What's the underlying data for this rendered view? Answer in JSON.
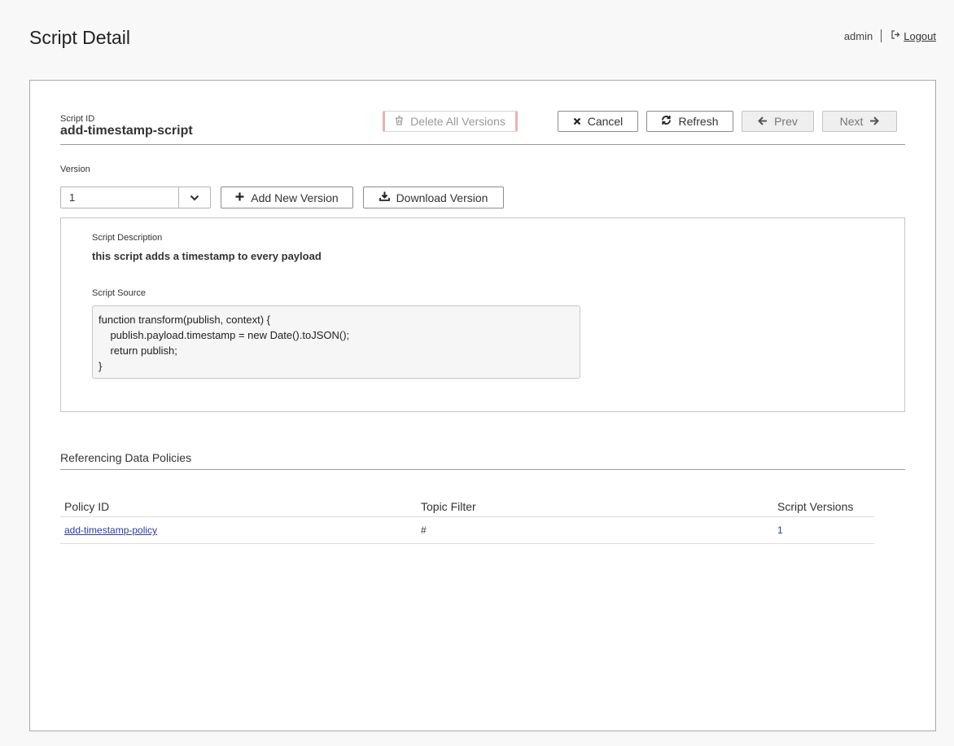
{
  "page": {
    "title": "Script Detail"
  },
  "user": {
    "name": "admin",
    "logout_label": "Logout"
  },
  "script": {
    "id_label": "Script ID",
    "id_value": "add-timestamp-script",
    "version_label": "Version",
    "version_value": "1",
    "description_label": "Script Description",
    "description_value": "this script adds a timestamp to every payload",
    "source_label": "Script Source",
    "source_code": "function transform(publish, context) {\n    publish.payload.timestamp = new Date().toJSON();\n    return publish;\n}"
  },
  "toolbar": {
    "delete_all": "Delete All Versions",
    "cancel": "Cancel",
    "refresh": "Refresh",
    "prev": "Prev",
    "next": "Next"
  },
  "version_actions": {
    "add": "Add New Version",
    "download": "Download Version"
  },
  "policies": {
    "section_title": "Referencing Data Policies",
    "headers": [
      "Policy ID",
      "Topic Filter",
      "Script Versions"
    ],
    "rows": [
      {
        "policy_id": "add-timestamp-policy",
        "topic_filter": "#",
        "script_versions": "1"
      }
    ]
  }
}
